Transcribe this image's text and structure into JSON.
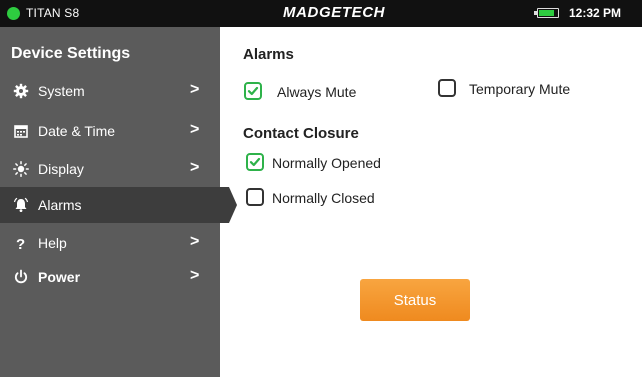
{
  "topbar": {
    "device_name": "TITAN S8",
    "brand": "MADGETECH",
    "time": "12:32 PM",
    "status_color": "#2ecc40",
    "battery_level": 0.85
  },
  "sidebar": {
    "title": "Device Settings",
    "items": [
      {
        "label": "System",
        "icon": "gear-icon",
        "has_chevron": true
      },
      {
        "label": "Date & Time",
        "icon": "calendar-icon",
        "has_chevron": true
      },
      {
        "label": "Display",
        "icon": "brightness-icon",
        "has_chevron": true
      },
      {
        "label": "Alarms",
        "icon": "bell-icon",
        "active": true,
        "has_chevron": false
      },
      {
        "label": "Help",
        "icon": "question-icon",
        "has_chevron": true
      },
      {
        "label": "Power",
        "icon": "power-icon",
        "has_chevron": true
      }
    ],
    "chevron": ">"
  },
  "main": {
    "alarms": {
      "heading": "Alarms",
      "always_mute": {
        "label": "Always Mute",
        "checked": true
      },
      "temporary_mute": {
        "label": "Temporary Mute",
        "checked": false
      }
    },
    "contact_closure": {
      "heading": "Contact Closure",
      "normally_opened": {
        "label": "Normally Opened",
        "checked": true
      },
      "normally_closed": {
        "label": "Normally Closed",
        "checked": false
      }
    },
    "status_button": "Status"
  },
  "colors": {
    "accent_orange": "#f39528",
    "check_green": "#2eb24a",
    "sidebar_bg": "#5b5b5b",
    "sidebar_active": "#3d3d3d"
  }
}
